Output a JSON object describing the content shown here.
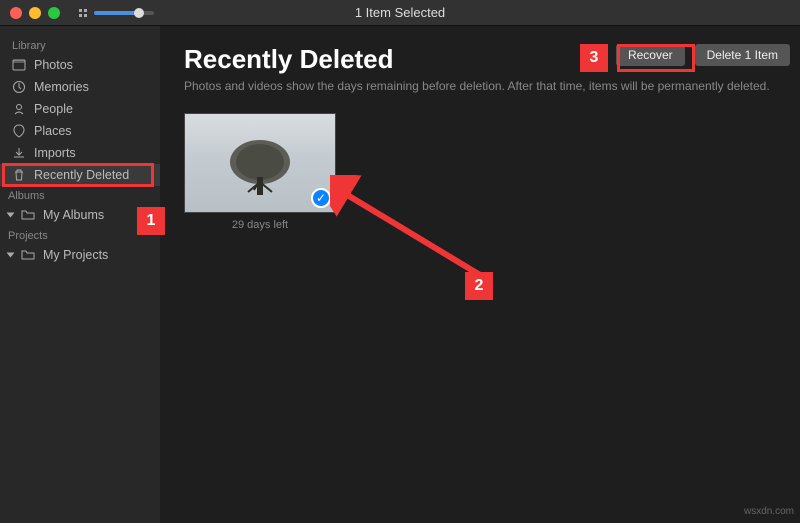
{
  "titlebar": {
    "title": "1 Item Selected"
  },
  "sidebar": {
    "sections": {
      "library": "Library",
      "albums": "Albums",
      "projects": "Projects"
    },
    "library_items": [
      {
        "icon": "photos-icon",
        "label": "Photos"
      },
      {
        "icon": "memories-icon",
        "label": "Memories"
      },
      {
        "icon": "people-icon",
        "label": "People"
      },
      {
        "icon": "places-icon",
        "label": "Places"
      },
      {
        "icon": "imports-icon",
        "label": "Imports"
      },
      {
        "icon": "trash-icon",
        "label": "Recently Deleted"
      }
    ],
    "albums_items": [
      {
        "icon": "folder-icon",
        "label": "My Albums"
      }
    ],
    "projects_items": [
      {
        "icon": "folder-icon",
        "label": "My Projects"
      }
    ]
  },
  "page": {
    "title": "Recently Deleted",
    "subtitle": "Photos and videos show the days remaining before deletion. After that time, items will be permanently deleted."
  },
  "toolbar": {
    "recover": "Recover",
    "delete": "Delete 1 Item"
  },
  "thumbnails": [
    {
      "caption": "29 days left",
      "selected": true
    }
  ],
  "annotations": {
    "box1": "1",
    "box2": "2",
    "box3": "3"
  },
  "watermark": "wsxdn.com"
}
